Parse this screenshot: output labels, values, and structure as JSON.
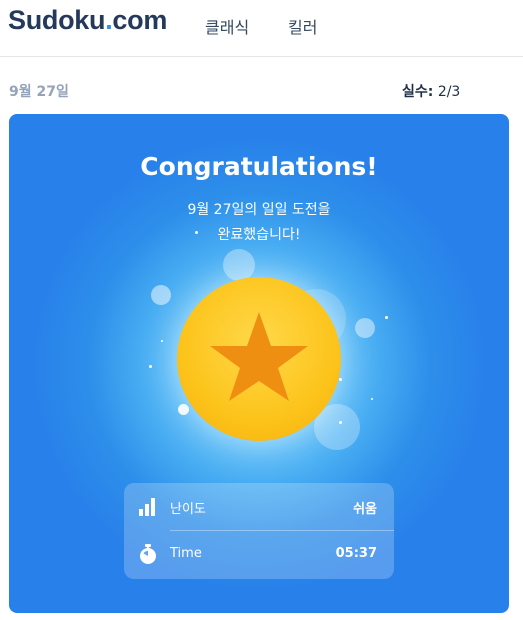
{
  "header": {
    "logo_main": "Sudoku",
    "logo_dot": ".",
    "logo_tld": "com",
    "nav": [
      "클래식",
      "킬러"
    ]
  },
  "info": {
    "date": "9월 27일",
    "mistakes_label": "실수:",
    "mistakes_value": "2/3"
  },
  "card": {
    "title": "Congratulations!",
    "subtitle_line1": "9월 27일의 일일 도전을",
    "subtitle_line2": "완료했습니다!",
    "stats": [
      {
        "icon": "bar-chart-icon",
        "label": "난이도",
        "value": "쉬움"
      },
      {
        "icon": "stopwatch-icon",
        "label": "Time",
        "value": "05:37"
      }
    ]
  },
  "colors": {
    "brand_dark": "#25395a",
    "brand_dot": "#3a8be6",
    "card_blue": "#2880ea",
    "medal_gold": "#fcc41b",
    "star_orange": "#ee8f12"
  }
}
